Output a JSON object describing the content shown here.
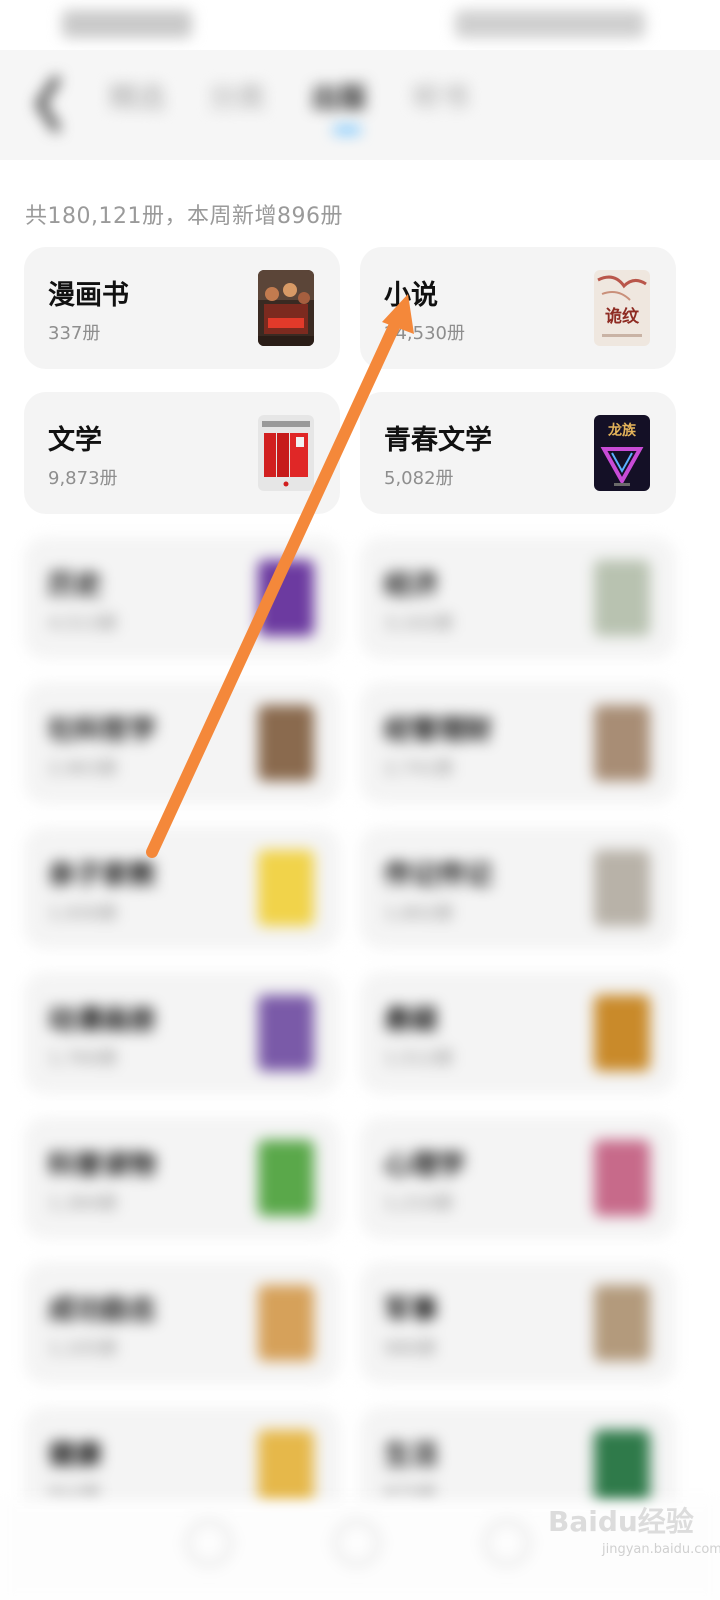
{
  "header": {
    "tabs": [
      {
        "label": "精选"
      },
      {
        "label": "分类"
      },
      {
        "label": "出版"
      },
      {
        "label": "听书"
      }
    ],
    "active_tab_index": 2
  },
  "summary": "共180,121册，本周新增896册",
  "categories": [
    {
      "name": "漫画书",
      "count": "337册"
    },
    {
      "name": "小说",
      "count": "24,530册"
    },
    {
      "name": "文学",
      "count": "9,873册"
    },
    {
      "name": "青春文学",
      "count": "5,082册"
    }
  ],
  "cover_titles": {
    "novel": "诡纹",
    "youth": "龙族"
  },
  "blurred_categories": [
    {
      "name": "历史",
      "count": "4,513册"
    },
    {
      "name": "经济",
      "count": "3,102册"
    },
    {
      "name": "社科哲学",
      "count": "2,963册"
    },
    {
      "name": "经管理财",
      "count": "2,741册"
    },
    {
      "name": "亲子家教",
      "count": "1,930册"
    },
    {
      "name": "传记传记",
      "count": "1,802册"
    },
    {
      "name": "动漫画册",
      "count": "1,760册"
    },
    {
      "name": "悬疑",
      "count": "1,512册"
    },
    {
      "name": "科普读物",
      "count": "1,384册"
    },
    {
      "name": "心理学",
      "count": "1,210册"
    },
    {
      "name": "成功励志",
      "count": "1,105册"
    },
    {
      "name": "军事",
      "count": "980册"
    },
    {
      "name": "健康",
      "count": "912册"
    },
    {
      "name": "生活",
      "count": "875册"
    }
  ],
  "watermark": {
    "text": "Baidu经验",
    "sub": "jingyan.baidu.com"
  },
  "colors": {
    "arrow": "#f4883a",
    "accent": "#6fc3ff",
    "card_bg": "#f4f4f4"
  }
}
